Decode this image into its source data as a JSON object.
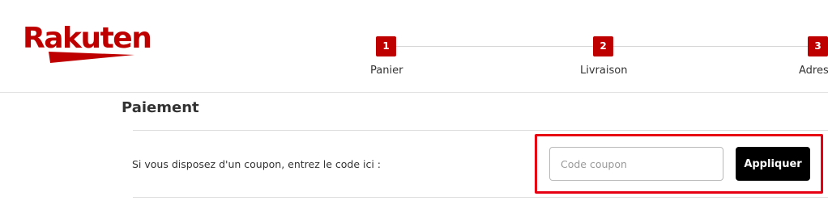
{
  "brand": {
    "logo_text": "Rakuten",
    "color": "#bf0000"
  },
  "steps": [
    {
      "number": "1",
      "label": "Panier"
    },
    {
      "number": "2",
      "label": "Livraison"
    },
    {
      "number": "3",
      "label": "Adres"
    }
  ],
  "payment": {
    "title": "Paiement",
    "coupon_prompt": "Si vous disposez d'un coupon, entrez le code ici :",
    "coupon_value": "",
    "coupon_placeholder": "Code coupon",
    "apply_label": "Appliquer",
    "highlight_color": "#e60012"
  }
}
